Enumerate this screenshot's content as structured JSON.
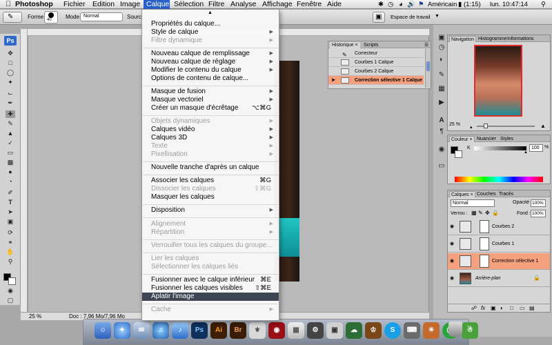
{
  "menubar": {
    "apple": "",
    "app": "Photoshop",
    "menus": [
      "Fichier",
      "Edition",
      "Image",
      "Calque",
      "Sélection",
      "Filtre",
      "Analyse",
      "Affichage",
      "Fenêtre",
      "Aide"
    ],
    "active_menu": "Calque",
    "status": {
      "input_source": "Américain",
      "battery": "(1:15)",
      "clock": "lun. 10:47:14"
    }
  },
  "options_bar": {
    "forme_label": "Forme :",
    "brush_size": "40",
    "mode_label": "Mode :",
    "mode_value": "Normal",
    "source_label": "Source",
    "workspace_label": "Espace de travail"
  },
  "calque_menu": {
    "items": [
      {
        "label": "Propriétés du calque...",
        "enabled": true
      },
      {
        "label": "Style de calque",
        "enabled": true,
        "submenu": true
      },
      {
        "label": "Filtre dynamique",
        "enabled": false,
        "submenu": true
      },
      {
        "label": "Nouveau calque de remplissage",
        "enabled": true,
        "submenu": true
      },
      {
        "label": "Nouveau calque de réglage",
        "enabled": true,
        "submenu": true
      },
      {
        "label": "Modifier le contenu du calque",
        "enabled": true,
        "submenu": true
      },
      {
        "label": "Options de contenu de calque...",
        "enabled": true
      },
      {
        "label": "Masque de fusion",
        "enabled": true,
        "submenu": true
      },
      {
        "label": "Masque vectoriel",
        "enabled": true,
        "submenu": true
      },
      {
        "label": "Créer un masque d'écrêtage",
        "enabled": true,
        "shortcut": "⌥⌘G"
      },
      {
        "label": "Objets dynamiques",
        "enabled": false,
        "submenu": true
      },
      {
        "label": "Calques vidéo",
        "enabled": true,
        "submenu": true
      },
      {
        "label": "Calques 3D",
        "enabled": true,
        "submenu": true
      },
      {
        "label": "Texte",
        "enabled": false,
        "submenu": true
      },
      {
        "label": "Pixellisation",
        "enabled": false,
        "submenu": true
      },
      {
        "label": "Nouvelle tranche d'après un calque",
        "enabled": true
      },
      {
        "label": "Associer les calques",
        "enabled": true,
        "shortcut": "⌘G"
      },
      {
        "label": "Dissocier les calques",
        "enabled": false,
        "shortcut": "⇧⌘G"
      },
      {
        "label": "Masquer les calques",
        "enabled": true
      },
      {
        "label": "Disposition",
        "enabled": true,
        "submenu": true
      },
      {
        "label": "Alignement",
        "enabled": false,
        "submenu": true
      },
      {
        "label": "Répartition",
        "enabled": false,
        "submenu": true
      },
      {
        "label": "Verrouiller tous les calques du groupe...",
        "enabled": false
      },
      {
        "label": "Lier les calques",
        "enabled": false
      },
      {
        "label": "Sélectionner les calques liés",
        "enabled": false
      },
      {
        "label": "Fusionner avec le calque inférieur",
        "enabled": true,
        "shortcut": "⌘E"
      },
      {
        "label": "Fusionner les calques visibles",
        "enabled": true,
        "shortcut": "⇧⌘E"
      },
      {
        "label": "Aplatir l'image",
        "enabled": true,
        "highlighted": true
      },
      {
        "label": "Cache",
        "enabled": false,
        "submenu": true
      }
    ]
  },
  "history_panel": {
    "tabs": [
      "Historique",
      "Scripts"
    ],
    "rows": [
      "Correcteur",
      "Courbes 1 Calque",
      "Courbes 2 Calque",
      "Correction sélective 1 Calque"
    ],
    "selected_row": "Correction sélective 1 Calque"
  },
  "navigation_panel": {
    "tabs": [
      "Navigation",
      "Histogramme",
      "Informations"
    ],
    "zoom": "25 %"
  },
  "color_panel": {
    "tabs": [
      "Couleur",
      "Nuancier",
      "Styles"
    ],
    "channel": "K",
    "value": "100",
    "unit": "%"
  },
  "layers_panel": {
    "tabs": [
      "Calques",
      "Couches",
      "Tracés"
    ],
    "blend_mode": "Normal",
    "opacity_label": "Opacité :",
    "opacity_value": "100%",
    "lock_label": "Verrou :",
    "fill_label": "Fond :",
    "fill_value": "100%",
    "layers": [
      {
        "name": "Courbes 2",
        "selected": false
      },
      {
        "name": "Courbes 1",
        "selected": false
      },
      {
        "name": "Correction sélective 1",
        "selected": true
      },
      {
        "name": "Arrière-plan",
        "selected": false
      }
    ],
    "footer_icons": [
      "link-icon",
      "fx-icon",
      "mask-icon",
      "adjustment-icon",
      "folder-icon",
      "new-layer-icon",
      "trash-icon"
    ]
  },
  "document": {
    "zoom": "25 %",
    "doc_info": "Doc : 7,96 Mo/7,96 Mo"
  },
  "dock": {
    "apps": [
      "Finder",
      "Safari",
      "Mail",
      "iTunes",
      "Photoshop",
      "Illustrator",
      "Bridge",
      "Plans",
      "Calendrier",
      "Photo Booth",
      "Aperçu",
      "Préférences",
      "Skype",
      "Activité",
      "Chrome",
      "Transmission",
      "Corbeille"
    ]
  },
  "colors": {
    "menu_highlight": "#3d4452",
    "menubar_active": "#2a60c8",
    "selected_layer": "#f5a17e",
    "nav_frame": "#e52a2a"
  }
}
